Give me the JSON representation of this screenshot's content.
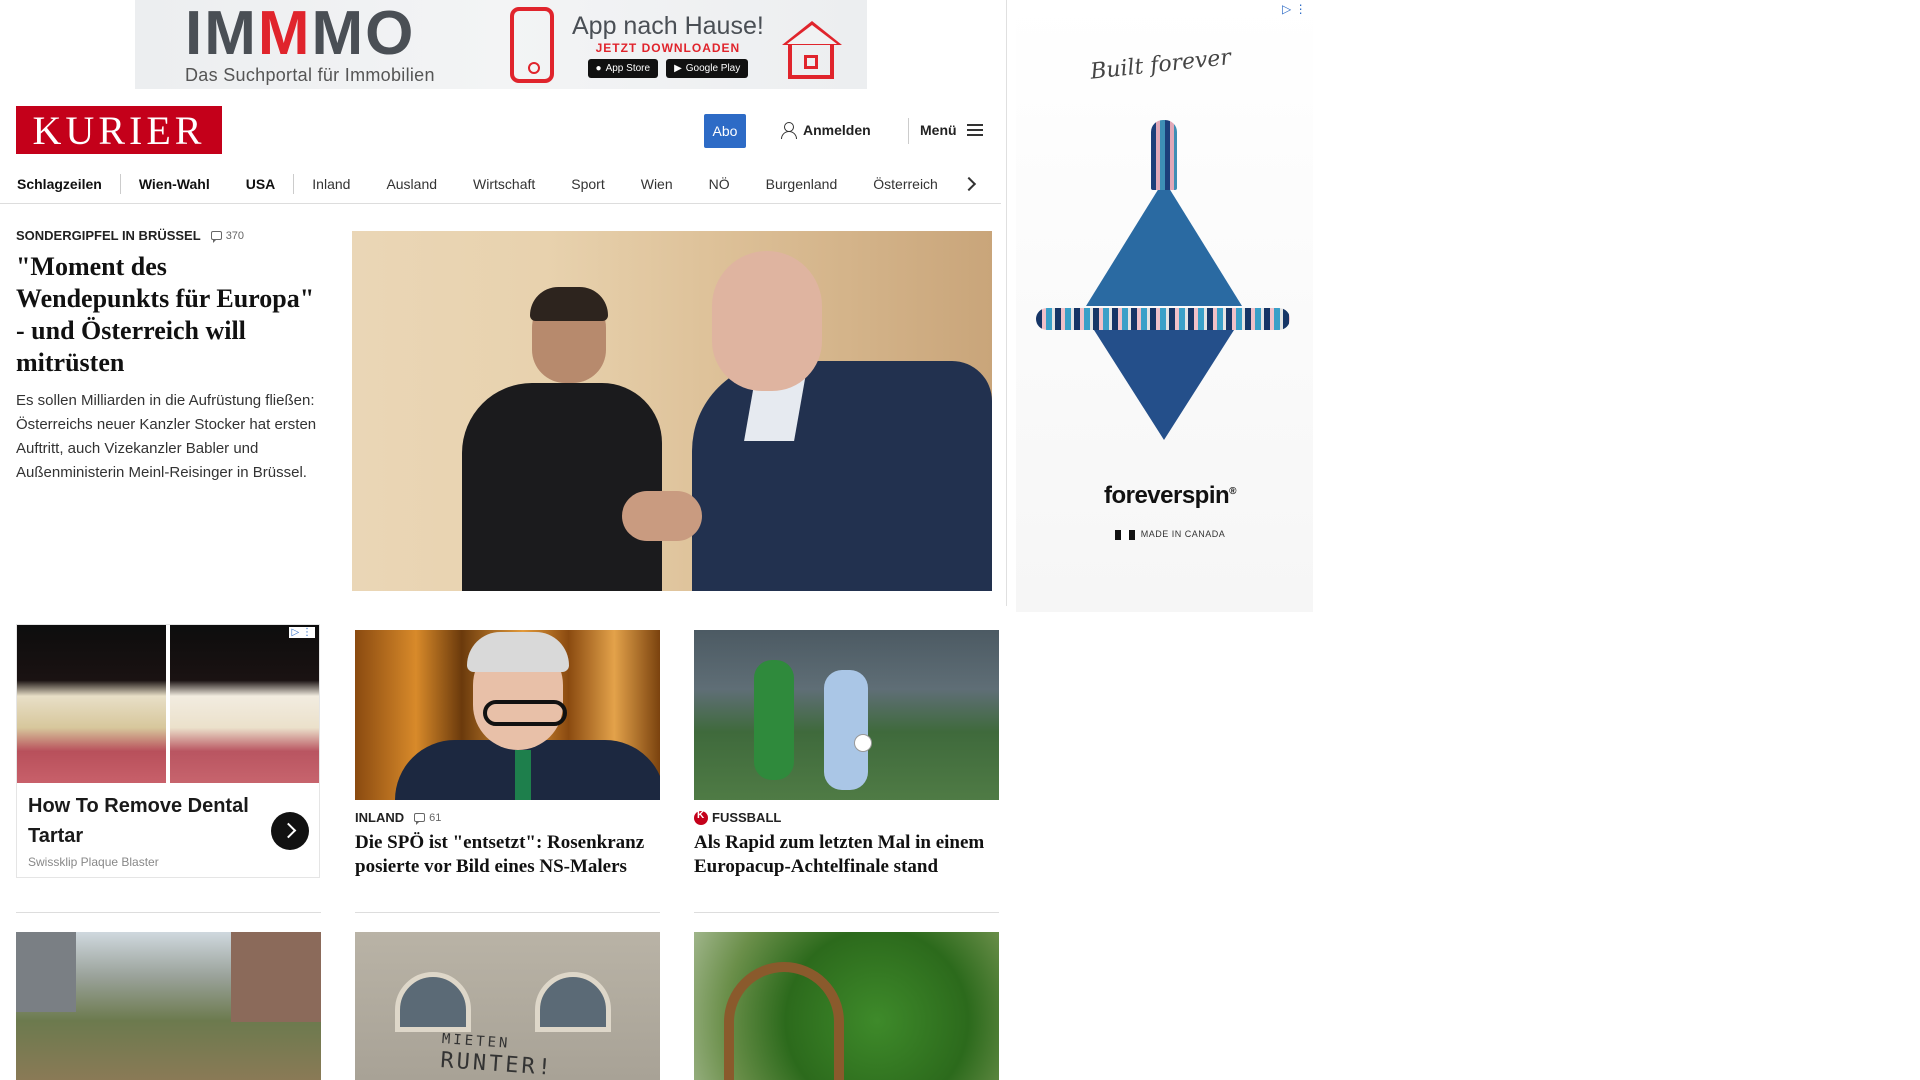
{
  "top_ad": {
    "brand": "IMMMO",
    "tagline": "Das Suchportal für Immobilien",
    "headline": "App nach Hause!",
    "cta": "JETZT DOWNLOADEN",
    "store1": "App Store",
    "store2": "Google Play"
  },
  "header": {
    "logo": "KURIER",
    "abo": "Abo",
    "login": "Anmelden",
    "menu": "Menü"
  },
  "nav": {
    "items": [
      "Schlagzeilen",
      "Wien-Wahl",
      "USA",
      "Inland",
      "Ausland",
      "Wirtschaft",
      "Sport",
      "Wien",
      "NÖ",
      "Burgenland",
      "Österreich"
    ]
  },
  "lead": {
    "kicker": "SONDERGIPFEL IN BRÜSSEL",
    "comments": "370",
    "headline": "\"Moment des Wendepunkts für Europa\" - und Österreich will mitrüsten",
    "teaser": "Es sollen Milliarden in die Aufrüstung fließen: Österreichs neuer Kanzler Stocker hat ersten Auftritt, auch Vizekanzler Babler und Außenministerin Meinl-Reisinger in Brüssel."
  },
  "ad_card": {
    "title": "How To Remove Dental Tartar",
    "source": "Swissklip Plaque Blaster"
  },
  "cards": [
    {
      "kicker": "INLAND",
      "comments": "61",
      "headline": "Die SPÖ ist \"entsetzt\": Rosenkranz posierte vor Bild eines NS-Malers"
    },
    {
      "kicker": "FUSSBALL",
      "headline": "Als Rapid zum letzten Mal in einem Europacup-Achtelfinale stand"
    }
  ],
  "row3": {
    "graffiti_line1": "MIETEN",
    "graffiti_line2": "RUNTER!"
  },
  "side_ad": {
    "script": "Built forever",
    "brand": "foreverspin",
    "made_in": "MADE IN CANADA"
  },
  "colors": {
    "brand_red": "#c4001a",
    "abo_blue": "#2d6bc6"
  }
}
